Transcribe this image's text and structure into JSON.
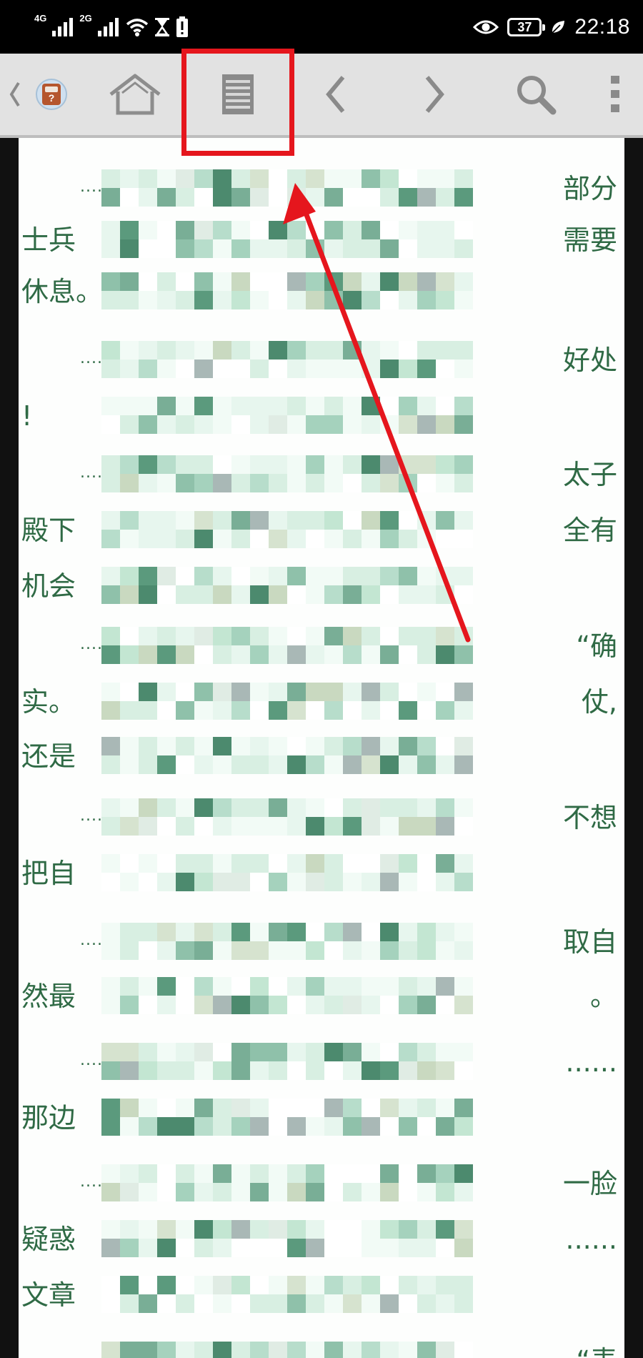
{
  "status_bar": {
    "network_primary": "4G",
    "network_secondary": "2G",
    "battery_level": "37",
    "time": "22:18",
    "icons": [
      "signal-icon",
      "wifi-icon",
      "hourglass-icon",
      "battery-alert-icon",
      "eye-icon",
      "battery-icon",
      "leaf-icon"
    ]
  },
  "toolbar": {
    "app_badge_mark": "?",
    "buttons": [
      "back-chevron-icon",
      "app-badge-icon",
      "home-icon",
      "table-of-contents-icon",
      "prev-chapter-icon",
      "next-chapter-icon",
      "search-icon",
      "more-options-icon"
    ],
    "highlighted_button": "table-of-contents-icon"
  },
  "colors": {
    "toolbar_bg": "#e2e2e2",
    "page_bg": "#fdfefd",
    "text": "#2f6a45",
    "annotation": "#e5161d"
  },
  "content": {
    "blocks": [
      {
        "lead": "......",
        "left": "",
        "right": "部分"
      },
      {
        "lead": "",
        "left": "士兵",
        "right": "需要"
      },
      {
        "lead": "",
        "left": "休息。",
        "right": ""
      },
      {
        "lead": "......",
        "left": "",
        "right": "好处"
      },
      {
        "lead": "",
        "left": "!",
        "right": ""
      },
      {
        "lead": "......",
        "left": "",
        "right": "太子"
      },
      {
        "lead": "",
        "left": "殿下",
        "right": "全有"
      },
      {
        "lead": "",
        "left": "机会",
        "right": ""
      },
      {
        "lead": "......",
        "left": "",
        "right": "“确"
      },
      {
        "lead": "",
        "left": "实。",
        "right": "仗,"
      },
      {
        "lead": "",
        "left": "还是",
        "right": ""
      },
      {
        "lead": "......",
        "left": "",
        "right": "不想"
      },
      {
        "lead": "",
        "left": "把自",
        "right": ""
      },
      {
        "lead": "......",
        "left": "",
        "right": "取自"
      },
      {
        "lead": "",
        "left": "然最",
        "right": "。"
      },
      {
        "lead": "......",
        "left": "",
        "right": "......"
      },
      {
        "lead": "",
        "left": "那边",
        "right": ""
      },
      {
        "lead": "......",
        "left": "",
        "right": "一脸"
      },
      {
        "lead": "",
        "left": "疑惑",
        "right": "......"
      },
      {
        "lead": "",
        "left": "文章",
        "right": ""
      },
      {
        "lead": "......",
        "left": "",
        "right": "“表"
      }
    ]
  }
}
